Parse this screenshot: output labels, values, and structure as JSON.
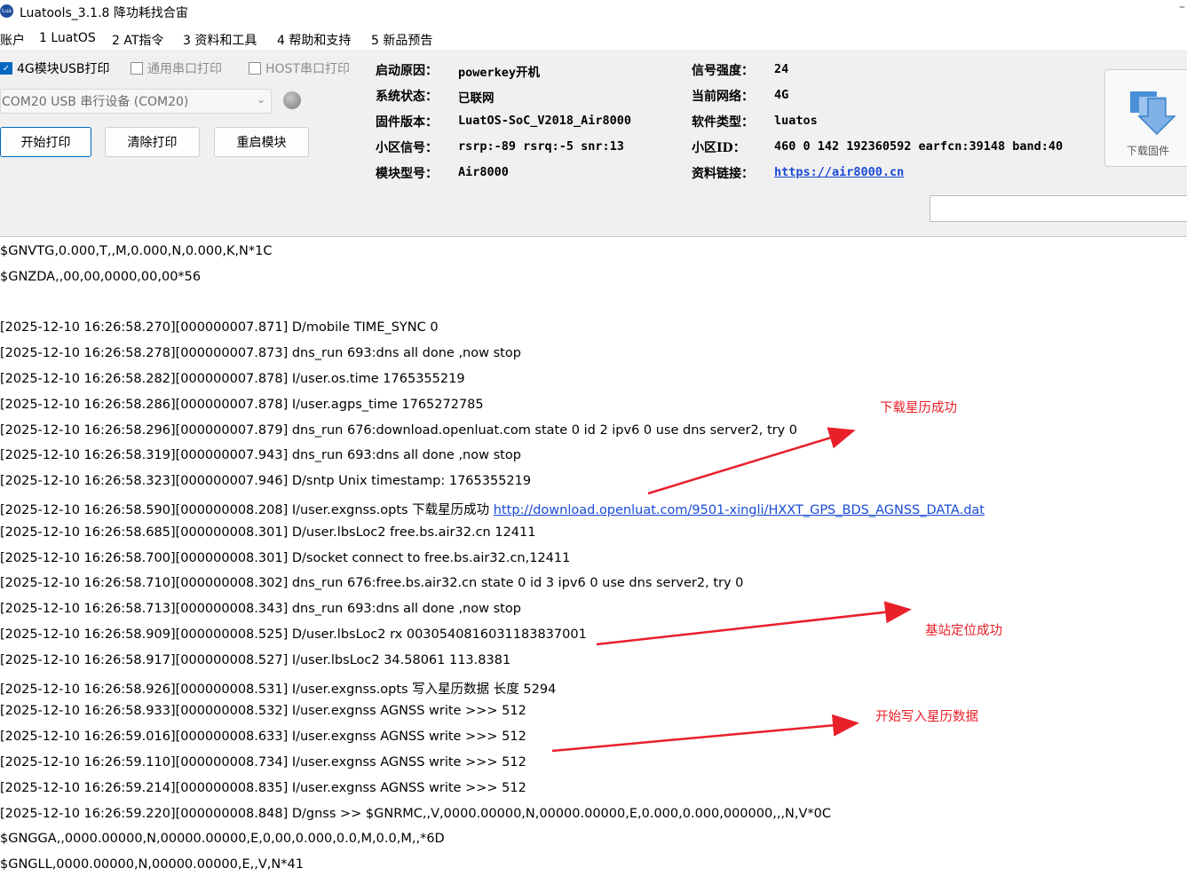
{
  "window": {
    "title": "Luatools_3.1.8 降功耗找合宙"
  },
  "menu": [
    "账户",
    "1 LuatOS",
    "2 AT指令",
    "3 资料和工具",
    "4 帮助和支持",
    "5 新品预告"
  ],
  "toolbar": {
    "chk_usb": "4G模块USB打印",
    "chk_uart": "通用串口打印",
    "chk_host": "HOST串口打印",
    "port": "COM20 USB 串行设备 (COM20)",
    "btn_start": "开始打印",
    "btn_clear": "清除打印",
    "btn_restart": "重启模块",
    "btn_download": "下载固件",
    "search_value": ""
  },
  "info": {
    "boot_label": "启动原因：",
    "boot": "powerkey开机",
    "status_label": "系统状态：",
    "status": "已联网",
    "fw_label": "固件版本：",
    "fw": "LuatOS-SoC_V2018_Air8000",
    "cell_label": "小区信号：",
    "cell": "rsrp:-89 rsrq:-5 snr:13",
    "model_label": "模块型号：",
    "model": "Air8000",
    "signal_label": "信号强度：",
    "signal": "24",
    "net_label": "当前网络：",
    "net": "4G",
    "sw_label": "软件类型：",
    "sw": "luatos",
    "cid_label": "小区ID：",
    "cid": "460 0 142 192360592 earfcn:39148 band:40",
    "link_label": "资料链接：",
    "link": "https://air8000.cn"
  },
  "log": [
    "$GNVTG,0.000,T,,M,0.000,N,0.000,K,N*1C",
    "$GNZDA,,00,00,0000,00,00*56",
    "",
    "[2025-12-10 16:26:58.270][000000007.871] D/mobile TIME_SYNC 0",
    "[2025-12-10 16:26:58.278][000000007.873] dns_run 693:dns all done ,now stop",
    "[2025-12-10 16:26:58.282][000000007.878] I/user.os.time 1765355219",
    "[2025-12-10 16:26:58.286][000000007.878] I/user.agps_time 1765272785",
    "[2025-12-10 16:26:58.296][000000007.879] dns_run 676:download.openluat.com state 0 id 2 ipv6 0 use dns server2, try 0",
    "[2025-12-10 16:26:58.319][000000007.943] dns_run 693:dns all done ,now stop",
    "[2025-12-10 16:26:58.323][000000007.946] D/sntp Unix timestamp: 1765355219",
    "[2025-12-10 16:26:58.590][000000008.208] I/user.exgnss.opts 下载星历成功 ",
    "[2025-12-10 16:26:58.685][000000008.301] D/user.lbsLoc2 free.bs.air32.cn 12411",
    "[2025-12-10 16:26:58.700][000000008.301] D/socket connect to free.bs.air32.cn,12411",
    "[2025-12-10 16:26:58.710][000000008.302] dns_run 676:free.bs.air32.cn state 0 id 3 ipv6 0 use dns server2, try 0",
    "[2025-12-10 16:26:58.713][000000008.343] dns_run 693:dns all done ,now stop",
    "[2025-12-10 16:26:58.909][000000008.525] D/user.lbsLoc2 rx 003054081603118383700​1",
    "[2025-12-10 16:26:58.917][000000008.527] I/user.lbsLoc2 34.58061 113.8381",
    "[2025-12-10 16:26:58.926][000000008.531] I/user.exgnss.opts 写入星历数据 长度 5294",
    "[2025-12-10 16:26:58.933][000000008.532] I/user.exgnss AGNSS write >>> 512",
    "[2025-12-10 16:26:59.016][000000008.633] I/user.exgnss AGNSS write >>> 512",
    "[2025-12-10 16:26:59.110][000000008.734] I/user.exgnss AGNSS write >>> 512",
    "[2025-12-10 16:26:59.214][000000008.835] I/user.exgnss AGNSS write >>> 512",
    "[2025-12-10 16:26:59.220][000000008.848] D/gnss >> $GNRMC,,V,0000.00000,N,00000.00000,E,0.000,0.000,000000,,,N,V*0C",
    "$GNGGA,,0000.00000,N,00000.00000,E,0,00,0.000,0.0,M,0.0,M,,*6D",
    "$GNGLL,0000.00000,N,00000.00000,E,,V,N*41"
  ],
  "log_link": "http://download.openluat.com/9501-xingli/HXXT_GPS_BDS_AGNSS_DATA.dat",
  "annotations": {
    "a1": "下载星历成功",
    "a2": "基站定位成功",
    "a3": "开始写入星历数据",
    "color": "#e8202a"
  }
}
